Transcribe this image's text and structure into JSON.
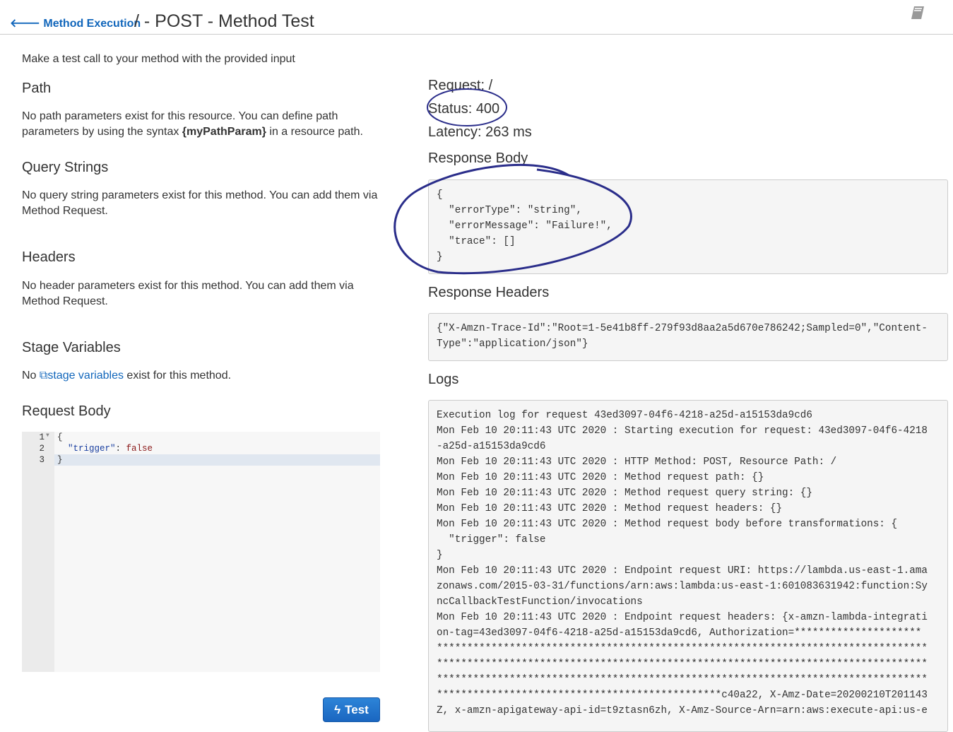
{
  "header": {
    "back_label": "Method Execution",
    "title": "/ - POST - Method Test",
    "book_icon": "book-icon"
  },
  "left": {
    "intro": "Make a test call to your method with the provided input",
    "path": {
      "heading": "Path",
      "text_before": "No path parameters exist for this resource. You can define path parameters by using the syntax ",
      "bold": "{myPathParam}",
      "text_after": " in a resource path."
    },
    "query": {
      "heading": "Query Strings",
      "text": "No query string parameters exist for this method. You can add them via Method Request."
    },
    "headers": {
      "heading": "Headers",
      "text": "No header parameters exist for this method. You can add them via Method Request."
    },
    "stage": {
      "heading": "Stage Variables",
      "before": "No ",
      "link": "stage variables",
      "after": " exist for this method."
    },
    "body": {
      "heading": "Request Body",
      "lines": [
        {
          "n": "1",
          "code": "{"
        },
        {
          "n": "2",
          "key": "\"trigger\"",
          "sep": ": ",
          "val": "false"
        },
        {
          "n": "3",
          "code": "}"
        }
      ]
    },
    "test_label": "Test"
  },
  "right": {
    "request": "Request: /",
    "status": "Status: 400",
    "latency": "Latency: 263 ms",
    "response_body_heading": "Response Body",
    "response_body": "{\n  \"errorType\": \"string\",\n  \"errorMessage\": \"Failure!\",\n  \"trace\": []\n}",
    "response_headers_heading": "Response Headers",
    "response_headers": "{\"X-Amzn-Trace-Id\":\"Root=1-5e41b8ff-279f93d8aa2a5d670e786242;Sampled=0\",\"Content-\nType\":\"application/json\"}",
    "logs_heading": "Logs",
    "logs": "Execution log for request 43ed3097-04f6-4218-a25d-a15153da9cd6\nMon Feb 10 20:11:43 UTC 2020 : Starting execution for request: 43ed3097-04f6-4218\n-a25d-a15153da9cd6\nMon Feb 10 20:11:43 UTC 2020 : HTTP Method: POST, Resource Path: /\nMon Feb 10 20:11:43 UTC 2020 : Method request path: {}\nMon Feb 10 20:11:43 UTC 2020 : Method request query string: {}\nMon Feb 10 20:11:43 UTC 2020 : Method request headers: {}\nMon Feb 10 20:11:43 UTC 2020 : Method request body before transformations: {\n  \"trigger\": false\n}\nMon Feb 10 20:11:43 UTC 2020 : Endpoint request URI: https://lambda.us-east-1.ama\nzonaws.com/2015-03-31/functions/arn:aws:lambda:us-east-1:601083631942:function:Sy\nncCallbackTestFunction/invocations\nMon Feb 10 20:11:43 UTC 2020 : Endpoint request headers: {x-amzn-lambda-integrati\non-tag=43ed3097-04f6-4218-a25d-a15153da9cd6, Authorization=*********************\n*********************************************************************************\n*********************************************************************************\n*********************************************************************************\n***********************************************c40a22, X-Amz-Date=20200210T201143\nZ, x-amzn-apigateway-api-id=t9ztasn6zh, X-Amz-Source-Arn=arn:aws:execute-api:us-e"
  }
}
